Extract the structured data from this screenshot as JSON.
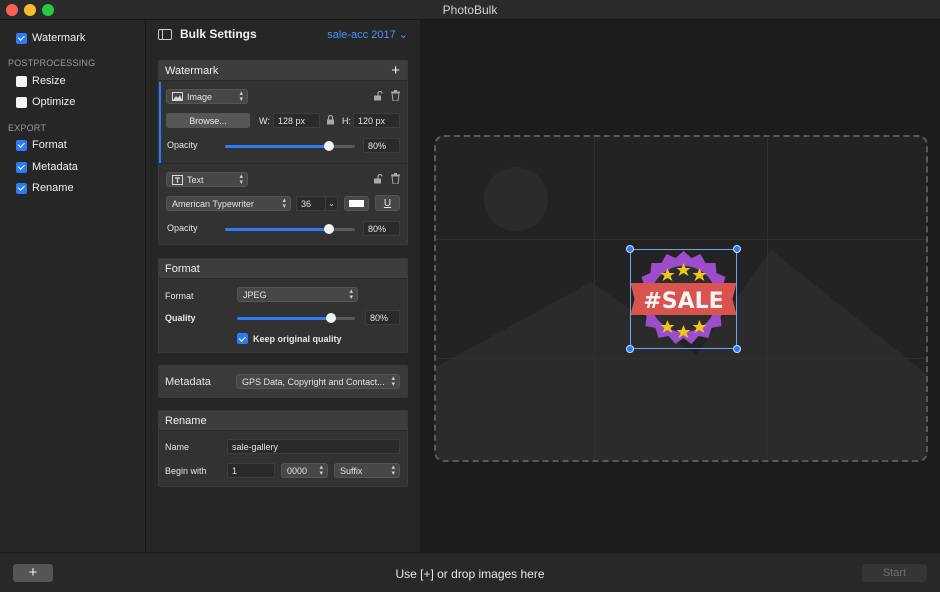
{
  "window": {
    "title": "PhotoBulk"
  },
  "sidebar": {
    "watermark": {
      "label": "Watermark",
      "checked": true
    },
    "postprocessing_heading": "POSTPROCESSING",
    "postprocessing": [
      {
        "label": "Resize",
        "checked": false
      },
      {
        "label": "Optimize",
        "checked": false
      }
    ],
    "export_heading": "EXPORT",
    "export": [
      {
        "label": "Format",
        "checked": true
      },
      {
        "label": "Metadata",
        "checked": true
      },
      {
        "label": "Rename",
        "checked": true
      }
    ]
  },
  "settings": {
    "title": "Bulk Settings",
    "preset": "sale-acc 2017",
    "watermark": {
      "title": "Watermark",
      "image_layer": {
        "type": "Image",
        "browse_label": "Browse...",
        "w_label": "W:",
        "width": "128 px",
        "h_label": "H:",
        "height": "120 px",
        "opacity_label": "Opacity",
        "opacity": "80%",
        "opacity_level": 0.8
      },
      "text_layer": {
        "type": "Text",
        "font": "American Typewriter",
        "size": "36",
        "color": "#ffffff",
        "opacity_label": "Opacity",
        "opacity": "80%",
        "opacity_level": 0.8
      }
    },
    "format": {
      "title": "Format",
      "format_label": "Format",
      "format_value": "JPEG",
      "quality_label": "Quality",
      "quality": "80%",
      "quality_level": 0.8,
      "keep_original_label": "Keep original quality",
      "keep_original": true
    },
    "metadata": {
      "title": "Metadata",
      "value": "GPS Data, Copyright and Contact..."
    },
    "rename": {
      "title": "Rename",
      "name_label": "Name",
      "name_value": "sale-gallery",
      "begin_label": "Begin with",
      "begin_value": "1",
      "digits": "0000",
      "position": "Suffix"
    }
  },
  "canvas": {
    "watermark_text": "#SALE",
    "colors": {
      "badge_purple": "#9b4dca",
      "badge_red": "#d9534f",
      "star": "#f0c419",
      "accent": "#2d7cf6"
    }
  },
  "bottombar": {
    "add_label": "+",
    "hint": "Use [+] or drop images here",
    "start_label": "Start"
  }
}
